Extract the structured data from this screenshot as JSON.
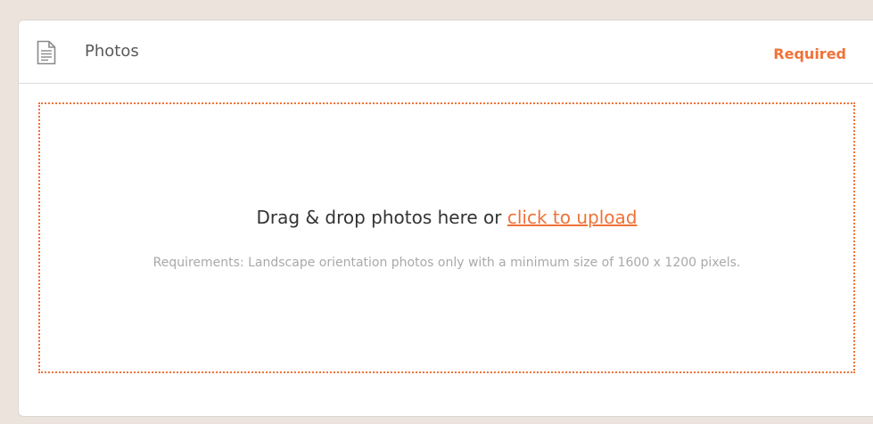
{
  "header": {
    "title": "Photos",
    "required_label": "Required",
    "icon": "document-icon"
  },
  "dropzone": {
    "main_text": "Drag & drop photos here or ",
    "link_text": "click to upload",
    "requirements": "Requirements: Landscape orientation photos only with a minimum size of 1600 x 1200 pixels."
  },
  "colors": {
    "accent": "#f07238",
    "background": "#ece4dc",
    "card": "#ffffff",
    "muted_text": "#a9a9a9"
  }
}
